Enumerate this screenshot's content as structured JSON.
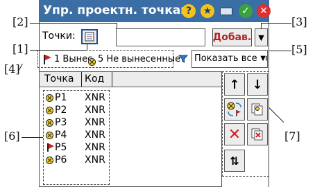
{
  "window": {
    "title": "Упр. проектн. точкам"
  },
  "toolbar": {
    "points_label": "Точки:",
    "search_value": "",
    "add_button": "Добав."
  },
  "status": {
    "stakeout_summary": "1 Вынес",
    "not_stakeout_summary": "5 Не вынесенные",
    "filter_value": "Показать все то"
  },
  "table": {
    "headers": [
      "Точка",
      "Код"
    ],
    "rows": [
      {
        "point": "P1",
        "code": "XNR",
        "status": "not_staked"
      },
      {
        "point": "P2",
        "code": "XNR",
        "status": "not_staked"
      },
      {
        "point": "P3",
        "code": "XNR",
        "status": "not_staked"
      },
      {
        "point": "P4",
        "code": "XNR",
        "status": "not_staked"
      },
      {
        "point": "P5",
        "code": "XNR",
        "status": "staked"
      },
      {
        "point": "P6",
        "code": "XNR",
        "status": "not_staked"
      }
    ]
  },
  "callouts": {
    "c1": "[1]",
    "c2": "[2]",
    "c3": "[3]",
    "c4": "[4]",
    "c5": "[5]",
    "c6": "[6]",
    "c7": "[7]"
  },
  "colors": {
    "titlebar": "#3a6ea5",
    "add_text": "#b22222",
    "flag": "#d42020",
    "marker": "#f2d22b",
    "close": "#e03030",
    "ok": "#3aa040"
  }
}
